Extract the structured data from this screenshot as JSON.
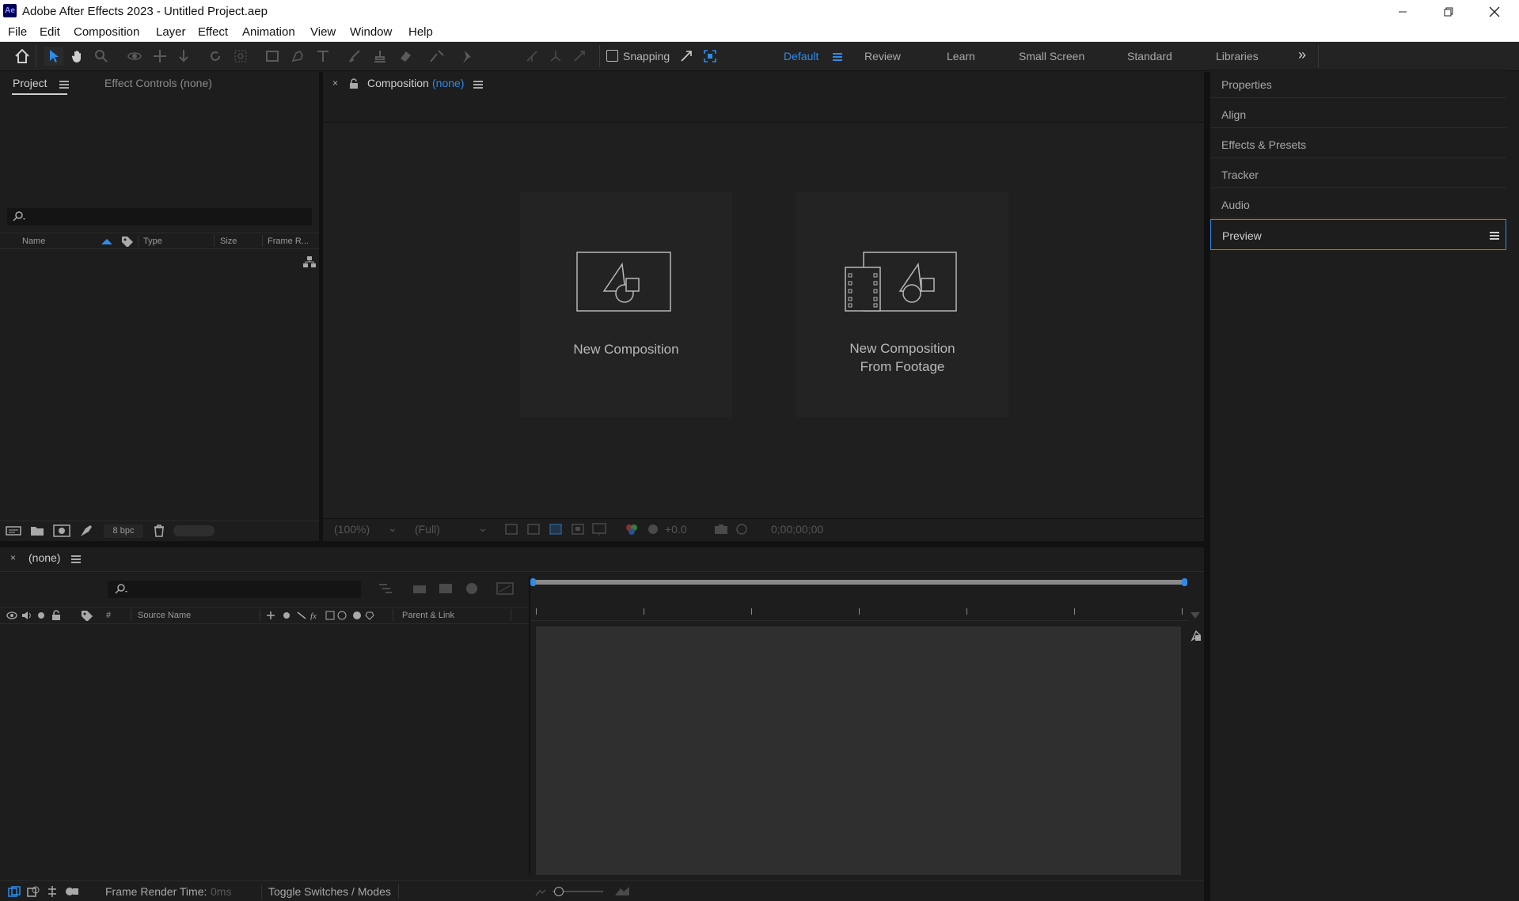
{
  "window": {
    "app_icon": "Ae",
    "title": "Adobe After Effects 2023 - Untitled Project.aep",
    "minimize_icon": "minimize-icon",
    "maximize_icon": "restore-icon",
    "close_icon": "close-icon"
  },
  "menu": [
    "File",
    "Edit",
    "Composition",
    "Layer",
    "Effect",
    "Animation",
    "View",
    "Window",
    "Help"
  ],
  "toolbar": {
    "snapping_label": "Snapping",
    "workspaces": [
      "Default",
      "Review",
      "Learn",
      "Small Screen",
      "Standard",
      "Libraries"
    ],
    "active_workspace": "Default",
    "more_label": "»"
  },
  "project_panel": {
    "tab_project": "Project",
    "tab_effect_controls": "Effect Controls (none)",
    "columns": [
      "Name",
      "Type",
      "Size",
      "Frame R..."
    ],
    "bpc_label": "8 bpc"
  },
  "composition_panel": {
    "tab_label": "Composition",
    "tab_value": "(none)",
    "new_composition": "New Composition",
    "new_from_footage_line1": "New Composition",
    "new_from_footage_line2": "From Footage",
    "zoom": "(100%)",
    "resolution": "(Full)",
    "exposure": "+0.0",
    "timecode": "0;00;00;00"
  },
  "right_panel": {
    "items": [
      "Properties",
      "Align",
      "Effects & Presets",
      "Tracker",
      "Audio",
      "Preview"
    ],
    "active": "Preview"
  },
  "timeline": {
    "tab_label": "(none)",
    "col_hash": "#",
    "col_source_name": "Source Name",
    "col_parent_link": "Parent & Link",
    "frame_render_label": "Frame Render Time:",
    "frame_render_value": "0ms",
    "toggle_label": "Toggle Switches / Modes"
  },
  "colors": {
    "accent": "#2d8ceb",
    "panel_bg": "#1d1d1d",
    "panel_dark": "#232323"
  }
}
